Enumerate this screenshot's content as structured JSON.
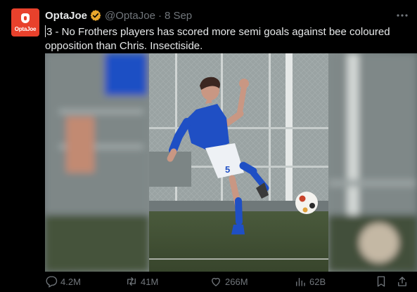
{
  "tweet": {
    "author_name": "OptaJoe",
    "avatar_text": "OptaJoe",
    "handle": "@OptaJoe",
    "separator": "·",
    "time": "8 Sep",
    "text": "3 - No Frothers players has scored more semi goals against bee coloured opposition than Chris. Insectiside.",
    "shirt_number": "5"
  },
  "actions": {
    "replies": "4.2M",
    "retweets": "41M",
    "likes": "266M",
    "views": "62B"
  },
  "colors": {
    "background": "#000000",
    "text": "#e7e9ea",
    "muted": "#71767b",
    "avatar_bg": "#e8412c",
    "verified_badge": "#e8a72c",
    "kit_blue": "#1f4fc4"
  },
  "icons": [
    "verified-badge-icon",
    "more-icon",
    "reply-icon",
    "retweet-icon",
    "like-icon",
    "views-icon",
    "bookmark-icon",
    "share-icon"
  ]
}
